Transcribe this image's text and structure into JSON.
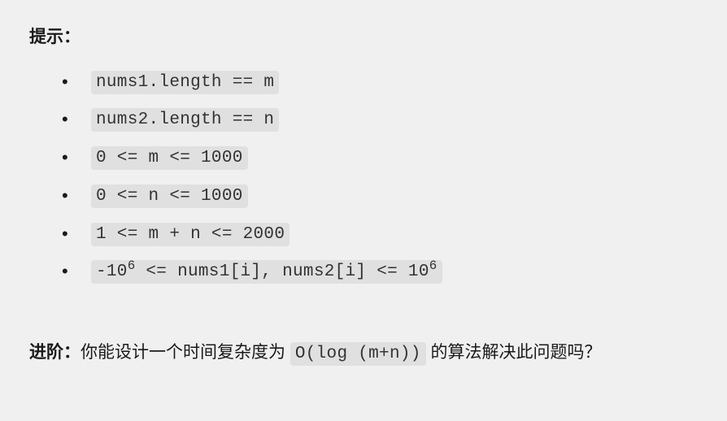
{
  "hints": {
    "label": "提示：",
    "items": [
      {
        "type": "code",
        "text": "nums1.length == m"
      },
      {
        "type": "code",
        "text": "nums2.length == n"
      },
      {
        "type": "code",
        "text": "0 <= m <= 1000"
      },
      {
        "type": "code",
        "text": "0 <= n <= 1000"
      },
      {
        "type": "code",
        "text": "1 <= m + n <= 2000"
      },
      {
        "type": "code-with-sup",
        "parts": [
          {
            "t": "text",
            "v": "-10"
          },
          {
            "t": "sup",
            "v": "6"
          },
          {
            "t": "text",
            "v": " <= nums1[i], nums2[i] <= 10"
          },
          {
            "t": "sup",
            "v": "6"
          }
        ]
      }
    ]
  },
  "followup": {
    "label": "进阶：",
    "text_before": "你能设计一个时间复杂度为 ",
    "code": "O(log (m+n))",
    "text_after": " 的算法解决此问题吗？"
  }
}
